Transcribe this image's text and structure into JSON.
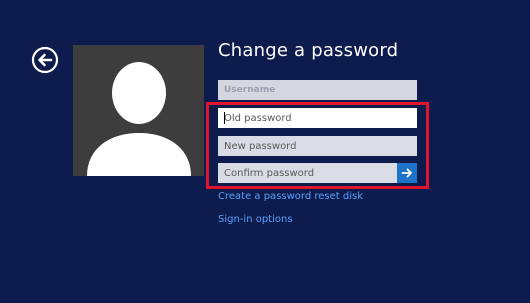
{
  "page": {
    "title": "Change a password"
  },
  "form": {
    "username_placeholder": "Username",
    "old_password_placeholder": "Old password",
    "new_password_placeholder": "New password",
    "confirm_password_placeholder": "Confirm password"
  },
  "links": {
    "reset_disk": "Create a password reset disk",
    "sign_in_options": "Sign-in options"
  },
  "icons": {
    "back": "back-arrow-circle",
    "submit": "right-arrow",
    "avatar": "user-silhouette"
  },
  "colors": {
    "background": "#0d1b4d",
    "accent": "#1e73c9",
    "link": "#5aa2ff",
    "highlight": "#e0142d",
    "avatar_bg": "#3d3d3d"
  }
}
